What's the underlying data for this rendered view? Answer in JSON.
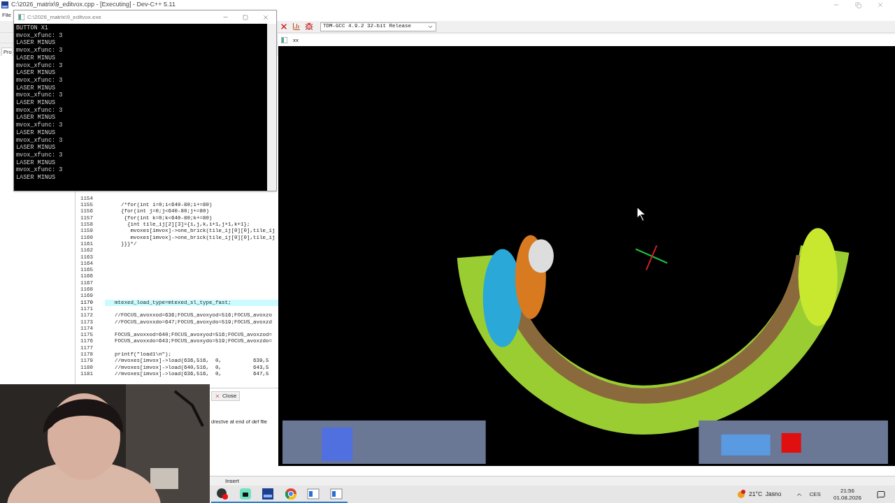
{
  "main_window": {
    "title": "C:\\2026_matrix\\9_editvox.cpp - [Executing] - Dev-C++ 5.11",
    "menu": [
      "File"
    ],
    "compiler": "TDM-GCC 4.9.2 32-bit Release",
    "panel_tab": "Pro",
    "editor": {
      "lines": [
        {
          "number": "1154",
          "highlighted": false
        },
        {
          "number": "1155",
          "code": "  /*for(int i=0;i<640-80;i+=80)",
          "highlighted": false
        },
        {
          "number": "1156",
          "code": "  {for(int j=0;j<640-80;j+=80)",
          "highlighted": false
        },
        {
          "number": "1157",
          "code": "   {for(int k=0;k<640-80;k+=80)",
          "highlighted": false
        },
        {
          "number": "1158",
          "code": "    {int tile_ij[2][3]={i,j,k,i+1,j+1,k+1};",
          "highlighted": false
        },
        {
          "number": "1159",
          "code": "     mvoxes[imvox]->one_brick(tile_ij[0][0],tile_ij",
          "highlighted": false
        },
        {
          "number": "1160",
          "code": "     mvoxes[imvox]->one_brick(tile_ij[0][0],tile_ij",
          "highlighted": false
        },
        {
          "number": "1161",
          "code": "  }}}*/",
          "highlighted": false
        },
        {
          "number": "1162",
          "highlighted": false
        },
        {
          "number": "1163",
          "highlighted": false
        },
        {
          "number": "1164",
          "highlighted": false
        },
        {
          "number": "1165",
          "highlighted": false
        },
        {
          "number": "1166",
          "highlighted": false
        },
        {
          "number": "1167",
          "highlighted": false
        },
        {
          "number": "1168",
          "highlighted": false
        },
        {
          "number": "1169",
          "highlighted": false
        },
        {
          "number": "1170",
          "code": "mtexed_load_type=mtexed_sl_type_fast;",
          "highlighted": true
        },
        {
          "number": "1171",
          "highlighted": false
        },
        {
          "number": "1172",
          "code": "//FOCUS_avoxxod=636;FOCUS_avoxyod=516;FOCUS_avoxzo",
          "highlighted": false
        },
        {
          "number": "1173",
          "code": "//FOCUS_avoxxdo=647;FOCUS_avoxydo=519;FOCUS_avoxzd",
          "highlighted": false
        },
        {
          "number": "1174",
          "highlighted": false
        },
        {
          "number": "1175",
          "code": "FOCUS_avoxxod=640;FOCUS_avoxyod=516;FOCUS_avoxzod=",
          "highlighted": false
        },
        {
          "number": "1176",
          "code": "FOCUS_avoxxdo=643;FOCUS_avoxydo=519;FOCUS_avoxzdo=",
          "highlighted": false
        },
        {
          "number": "1177",
          "highlighted": false
        },
        {
          "number": "1178",
          "code": "printf(\"load1\\n\");",
          "highlighted": false
        },
        {
          "number": "1179",
          "code": "//mvoxes[imvox]->load(636,516,  0,          639,5",
          "highlighted": false
        },
        {
          "number": "1180",
          "code": "//mvoxes[imvox]->load(640,516,  0,          643,5",
          "highlighted": false
        },
        {
          "number": "1181",
          "code": "//mvoxes[imvox]->load(636,516,  0,          647,5",
          "highlighted": false
        }
      ]
    },
    "messages": {
      "close_button": "Close",
      "message": "drectve at end of def file"
    },
    "status": "Insert"
  },
  "console": {
    "title": "C:\\2026_matrix\\9_editvox.exe",
    "lines": [
      "BUTTON X1",
      "mvox_xfunc: 3",
      "LASER MINUS",
      "mvox_xfunc: 3",
      "LASER MINUS",
      "mvox_xfunc: 3",
      "LASER MINUS",
      "mvox_xfunc: 3",
      "LASER MINUS",
      "mvox_xfunc: 3",
      "LASER MINUS",
      "mvox_xfunc: 3",
      "LASER MINUS",
      "mvox_xfunc: 3",
      "LASER MINUS",
      "mvox_xfunc: 3",
      "LASER MINUS",
      "mvox_xfunc: 3",
      "LASER MINUS",
      "mvox_xfunc: 3",
      "LASER MINUS"
    ]
  },
  "game_window": {
    "title": "xx"
  },
  "taskbar": {
    "apps": [
      {
        "kind": "recorder"
      },
      {
        "kind": "chat"
      },
      {
        "kind": "ide"
      },
      {
        "kind": "browser"
      },
      {
        "kind": "window"
      },
      {
        "kind": "window"
      }
    ],
    "weather": "21°C  Jasno",
    "language": "CES",
    "time": "21:56",
    "date": "01.08.2026"
  }
}
